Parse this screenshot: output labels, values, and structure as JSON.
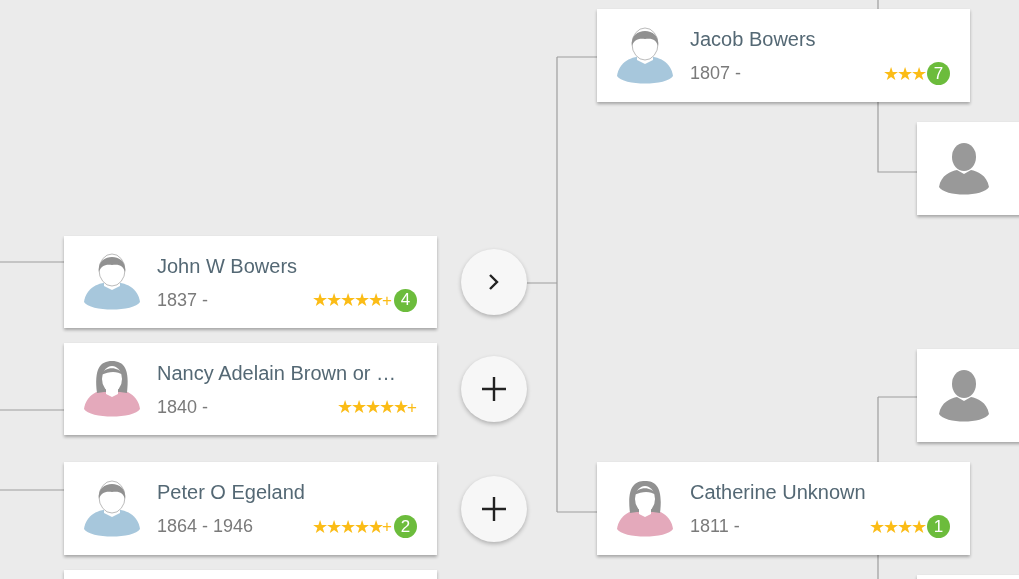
{
  "cards": [
    {
      "kind": "male",
      "name": "John W Bowers",
      "dates": "1837 -",
      "stars": 5,
      "rating_suffix": "+",
      "badge": "4"
    },
    {
      "kind": "female",
      "name": "Nancy Adelain Brown or …",
      "dates": "1840 -",
      "stars": 5,
      "rating_suffix": "+"
    },
    {
      "kind": "male",
      "name": "Peter O Egeland",
      "dates": "1864 - 1946",
      "stars": 5,
      "rating_suffix": "+",
      "badge": "2"
    },
    {
      "kind": "blank"
    },
    {
      "kind": "male",
      "name": "Jacob Bowers",
      "dates": "1807 -",
      "stars": 3,
      "badge": "7"
    },
    {
      "kind": "female",
      "name": "Catherine Unknown",
      "dates": "1811 -",
      "stars": 4,
      "badge": "1"
    },
    {
      "kind": "unknown"
    },
    {
      "kind": "unknown"
    },
    {
      "kind": "blank"
    }
  ],
  "buttons": [
    {
      "kind": "expand"
    },
    {
      "kind": "add"
    },
    {
      "kind": "add"
    }
  ]
}
